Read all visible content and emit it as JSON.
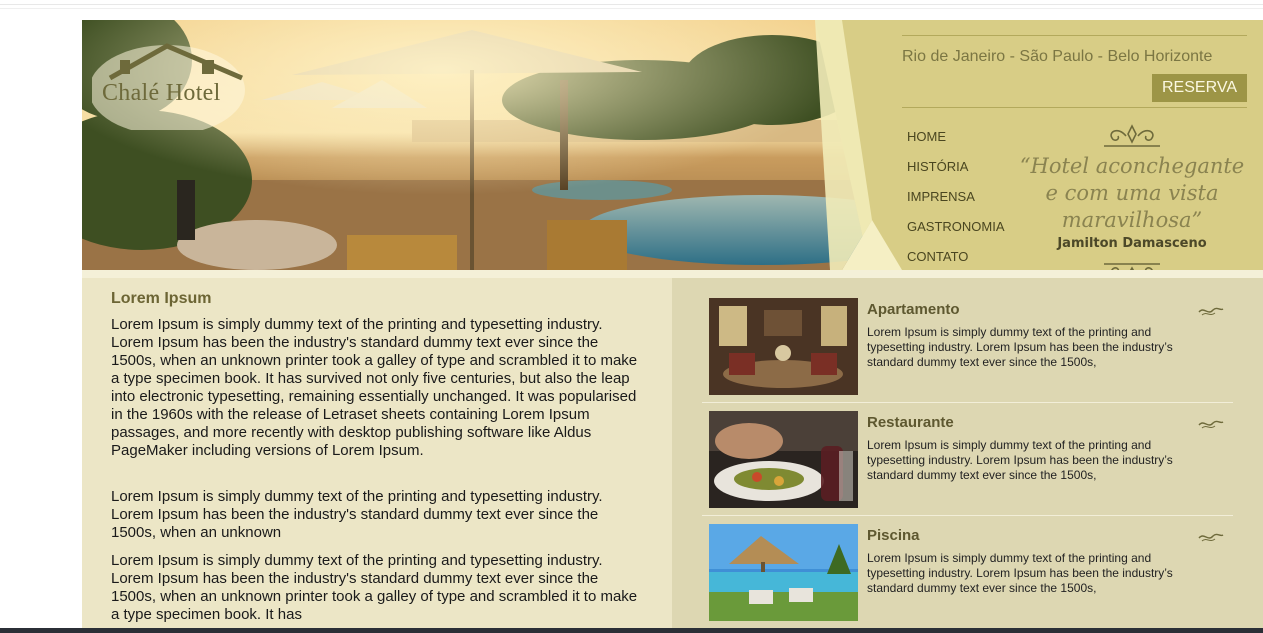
{
  "brand": {
    "name": "Chalé Hotel"
  },
  "header": {
    "cities": "Rio de Janeiro - São Paulo - Belo Horizonte",
    "reserve_label": "RESERVA",
    "nav": [
      {
        "label": "HOME"
      },
      {
        "label": "HISTÓRIA"
      },
      {
        "label": "IMPRENSA"
      },
      {
        "label": "GASTRONOMIA"
      },
      {
        "label": "CONTATO"
      }
    ],
    "quote": "“Hotel aconchegante e com uma vista maravilhosa”",
    "author": "Jamilton Damasceno"
  },
  "main": {
    "title": "Lorem Ipsum",
    "paragraphs": [
      "Lorem Ipsum is simply dummy text of the printing and typesetting industry. Lorem Ipsum has been the industry's standard dummy text ever since the 1500s, when an unknown printer took a galley of type and scrambled it to make a type specimen book. It has survived not only five centuries, but also the leap into electronic typesetting, remaining essentially unchanged. It was popularised in the 1960s with the release of Letraset sheets containing Lorem Ipsum passages, and more recently with desktop publishing software like Aldus PageMaker including versions of Lorem Ipsum.",
      "Lorem Ipsum is simply dummy text of the printing and typesetting industry. Lorem Ipsum has been the industry's standard dummy text ever since the 1500s, when an unknown",
      "Lorem Ipsum is simply dummy text of the printing and typesetting industry. Lorem Ipsum has been the industry's standard dummy text ever since the 1500s, when an unknown printer took a galley of type and scrambled it to make a type specimen book. It has"
    ]
  },
  "sidebar": {
    "cards": [
      {
        "title": "Apartamento",
        "text": "Lorem Ipsum is simply dummy text of the printing and typesetting industry. Lorem Ipsum has been the industry’s standard dummy text ever since the 1500s,"
      },
      {
        "title": "Restaurante",
        "text": "Lorem Ipsum is simply dummy text of the printing and typesetting industry. Lorem Ipsum has been the industry’s standard dummy text ever since the 1500s,"
      },
      {
        "title": "Piscina",
        "text": "Lorem Ipsum is simply dummy text of the printing and typesetting industry. Lorem Ipsum has been the industry’s standard dummy text ever since the 1500s,"
      }
    ]
  },
  "colors": {
    "accent": "#9d9546",
    "header_bg": "#d8cd86",
    "content_bg": "#ece6c6",
    "sidebar_bg": "#ddd7b2"
  }
}
